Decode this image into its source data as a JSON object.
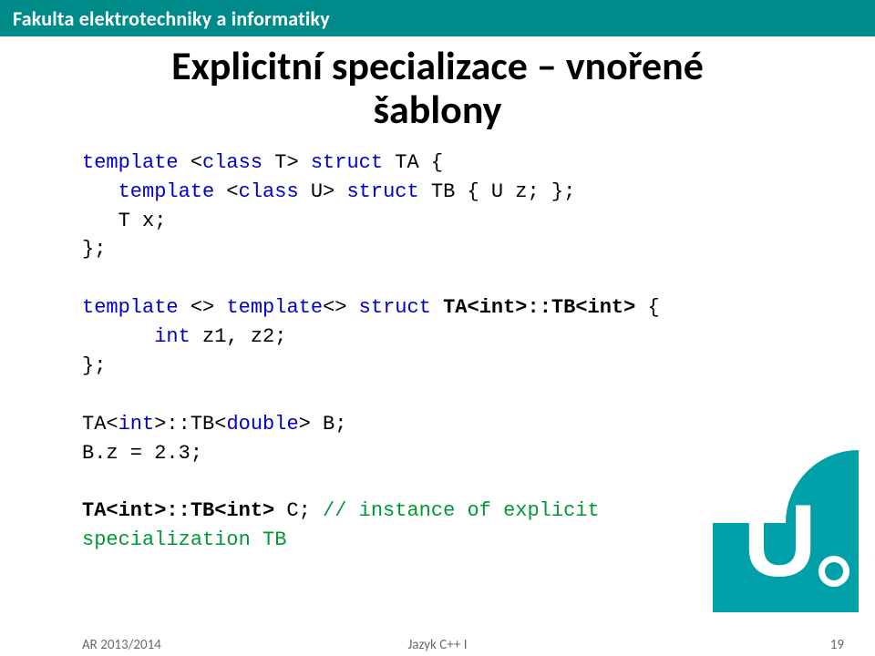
{
  "header": {
    "faculty": "Fakulta elektrotechniky a informatiky"
  },
  "title": {
    "line1": "Explicitní specializace – vnořené",
    "line2": "šablony"
  },
  "code": {
    "kw_template": "template",
    "kw_class": "class",
    "kw_struct": "struct",
    "kw_int": "int",
    "l1_a": " <",
    "l1_b": " T> ",
    "l1_c": " TA {",
    "l2_a": "   ",
    "l2_b": " <",
    "l2_c": " U> ",
    "l2_d": " TB { U z; };",
    "l3": "   T x;",
    "l4": "};",
    "l6_a": " <> ",
    "l6_b": "<> ",
    "l6_name": "TA<int>::TB<int>",
    "l6_c": " {",
    "l7_a": "      ",
    "l7_b": " z1, z2;",
    "l8": "};",
    "l10_a": "TA<",
    "l10_b": ">::TB<",
    "kw_double": "double",
    "l10_c": "> B;",
    "l11": "B.z = 2.3;",
    "l13_name": "TA<int>::TB<int>",
    "l13_a": " C; ",
    "l13_comment": "// instance of explicit\nspecialization TB"
  },
  "footer": {
    "left": "AR 2013/2014",
    "center": "Jazyk C++ I",
    "page": "19"
  }
}
